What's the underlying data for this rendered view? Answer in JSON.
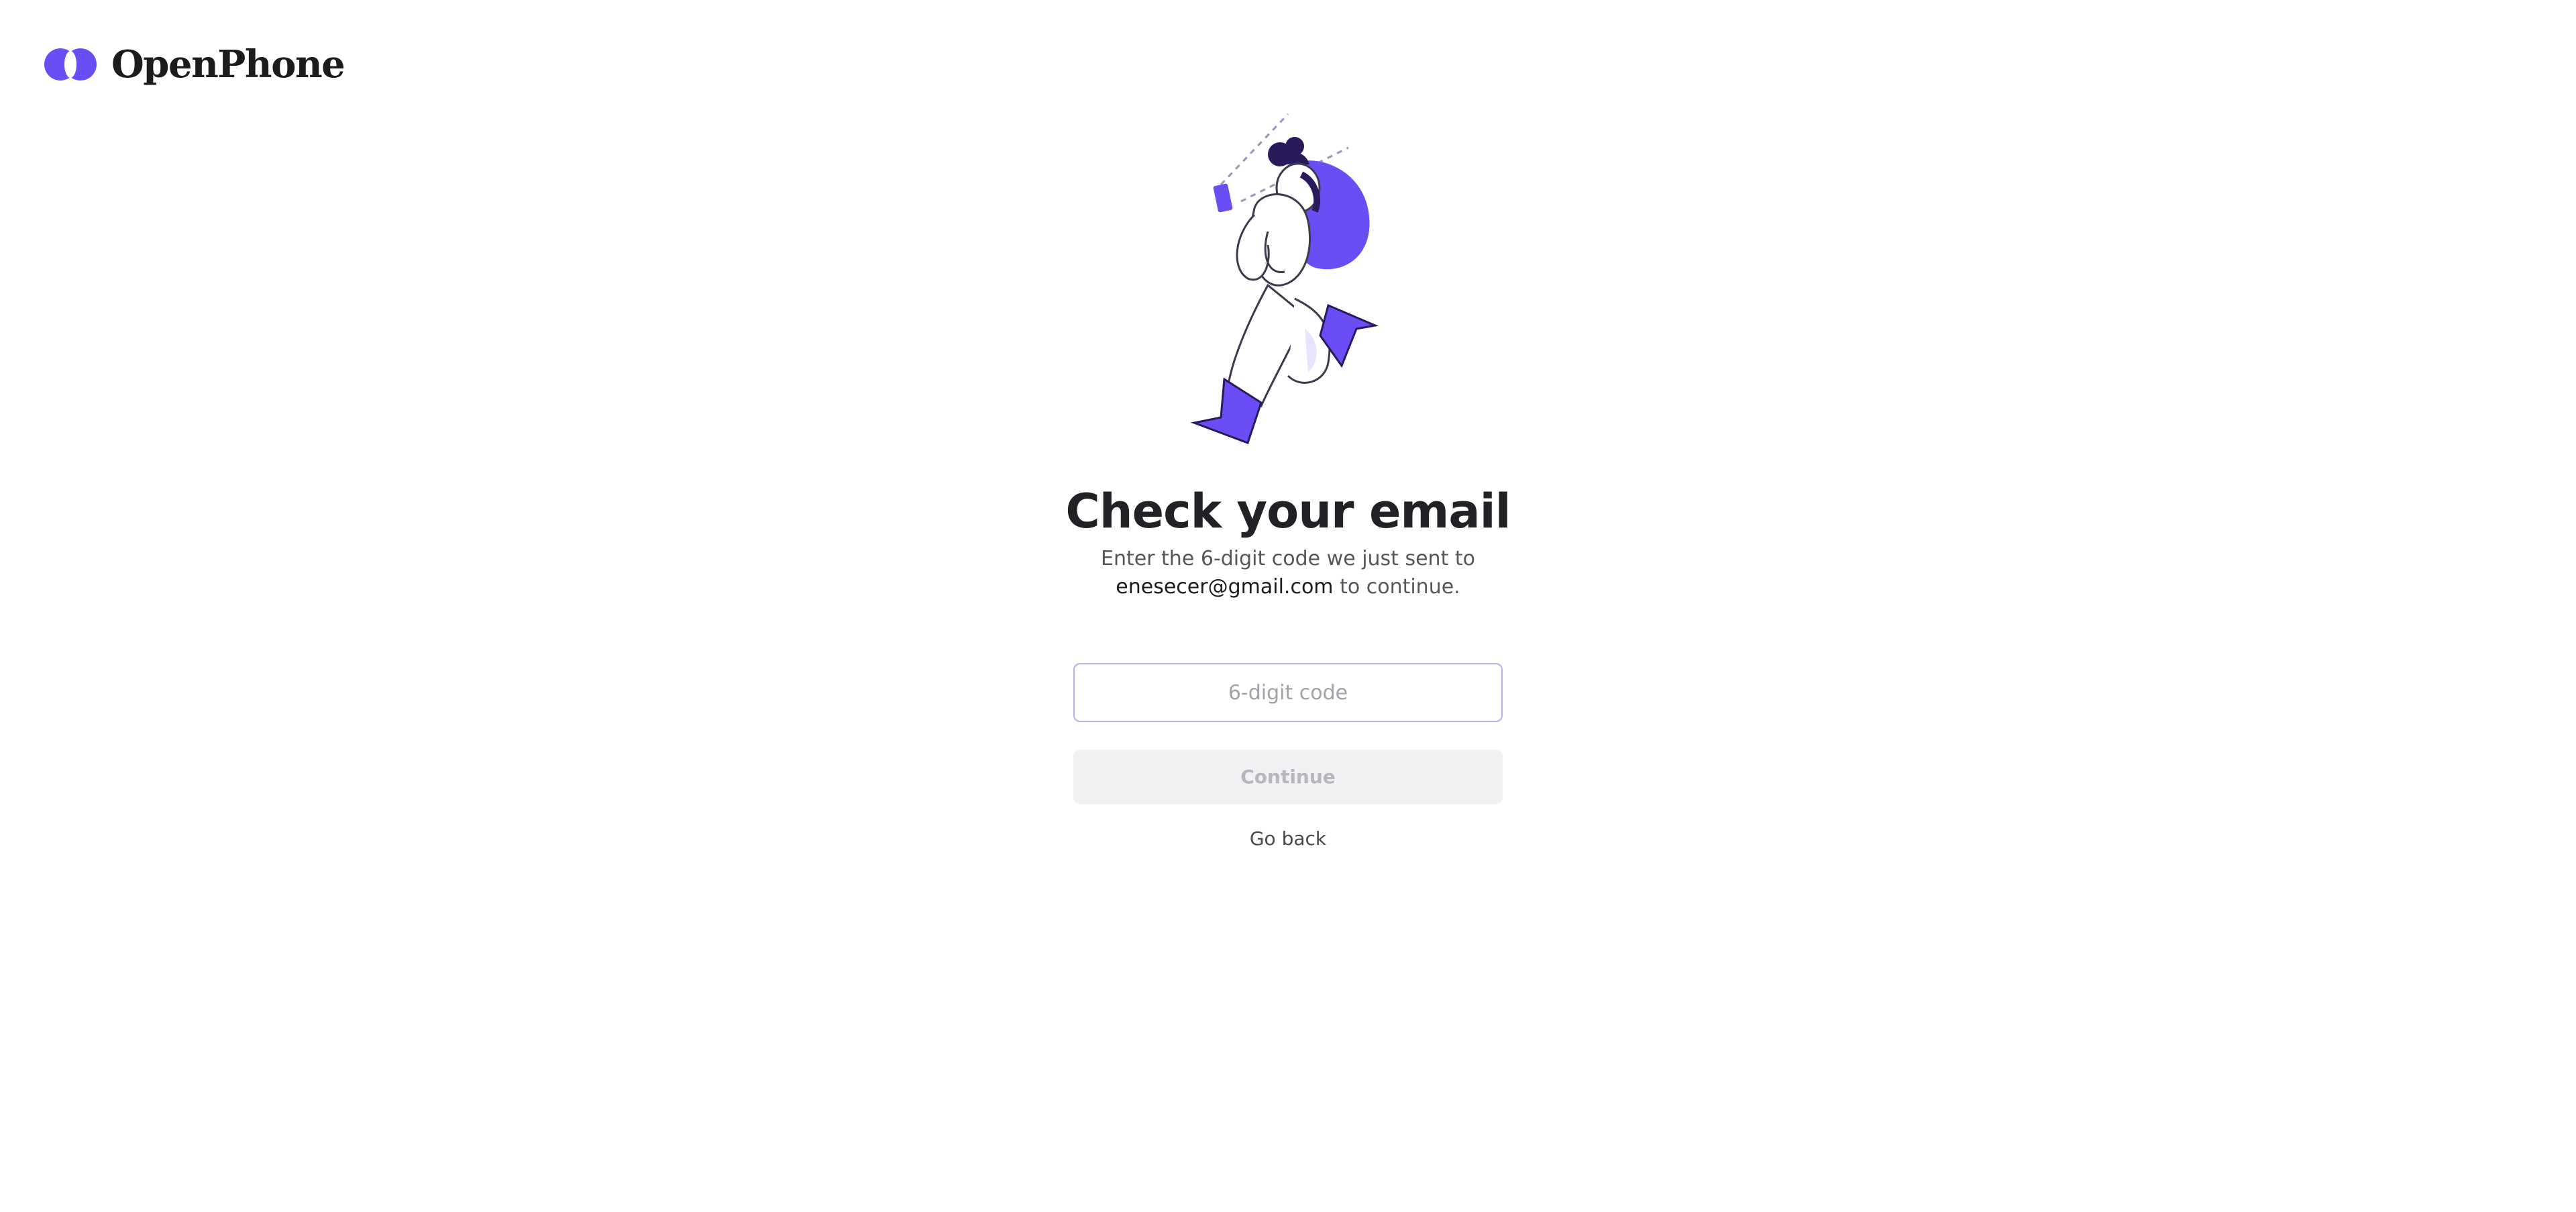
{
  "brand": {
    "name": "OpenPhone",
    "accent_color": "#6b4df5",
    "logo_icon": "openphone-logo-icon"
  },
  "illustration": {
    "icon": "person-running-with-phone-illustration"
  },
  "heading": "Check your email",
  "subtitle": {
    "line1": "Enter the 6-digit code we just sent to",
    "email": "enesecer@gmail.com",
    "suffix": " to continue."
  },
  "code_field": {
    "placeholder": "6-digit code",
    "value": ""
  },
  "buttons": {
    "continue_label": "Continue",
    "continue_state": "disabled",
    "go_back_label": "Go back"
  }
}
